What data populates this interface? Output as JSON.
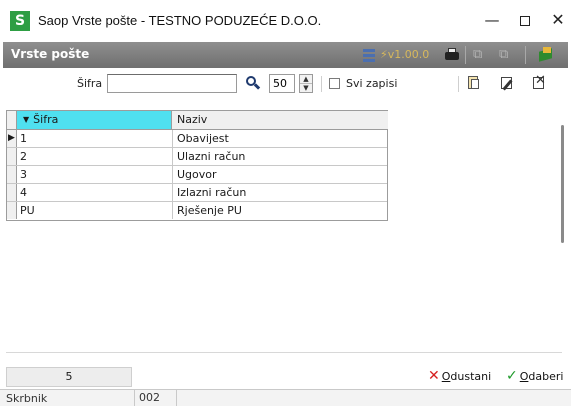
{
  "window": {
    "title": "Saop Vrste pošte  - TESTNO PODUZEĆE D.O.O.",
    "logo_letter": "S",
    "minimize": "—",
    "close": "✕"
  },
  "header": {
    "title": "Vrste pošte",
    "version": "v1.00.0"
  },
  "search": {
    "label": "Šifra",
    "value": "",
    "count_value": "50",
    "svi_zapisi_label": "Svi zapisi",
    "svi_zapisi_checked": false
  },
  "grid": {
    "columns": [
      "Šifra",
      "Naziv"
    ],
    "rows": [
      {
        "sifra": "1",
        "naziv": "Obavijest"
      },
      {
        "sifra": "2",
        "naziv": "Ulazni račun"
      },
      {
        "sifra": "3",
        "naziv": "Ugovor"
      },
      {
        "sifra": "4",
        "naziv": "Izlazni račun"
      },
      {
        "sifra": "PU",
        "naziv": "Rješenje PU"
      }
    ],
    "current_row_indicator": "▶"
  },
  "footer": {
    "record_count": "5",
    "cancel_label_first": "O",
    "cancel_label_rest": "dustani",
    "ok_label_first": "O",
    "ok_label_rest": "dabери"
  },
  "statusbar": {
    "user": "Skrbnik",
    "code": "002"
  },
  "colors": {
    "header_bg": "#7f7f7f",
    "sort_column_bg": "#4fe0f0",
    "cancel": "#d62020",
    "ok": "#1e9a2a",
    "logo": "#2e9e44"
  }
}
